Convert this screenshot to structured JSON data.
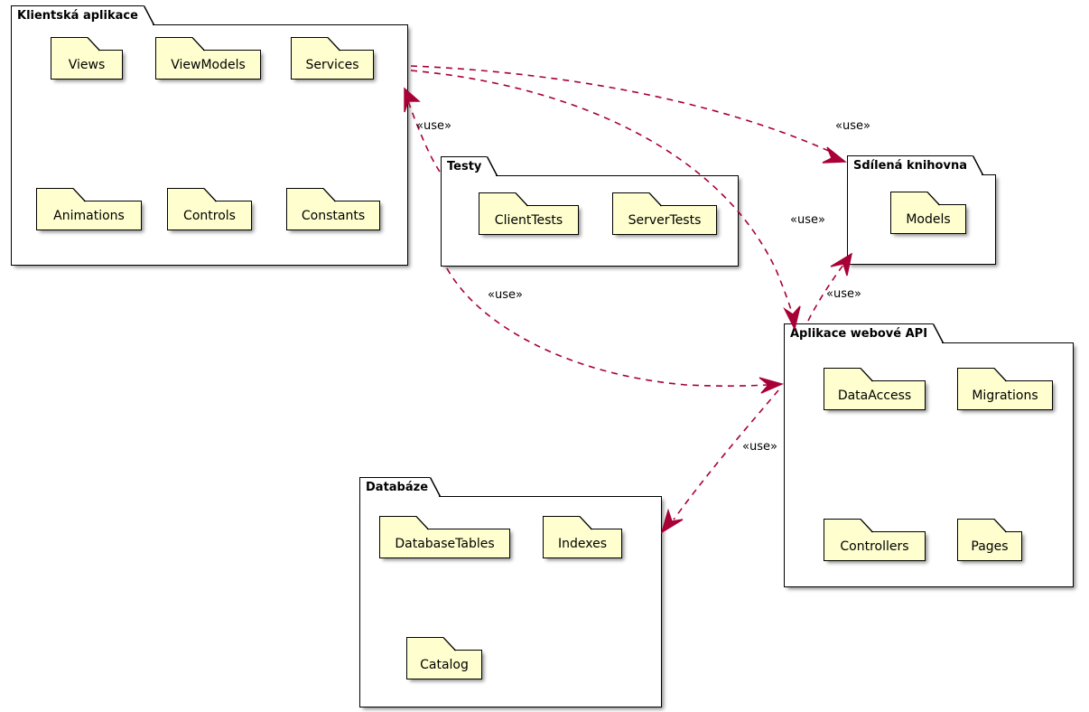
{
  "diagram": {
    "kind": "uml-package-diagram",
    "colors": {
      "node_fill": "#FEFECE",
      "node_border": "#000000",
      "package_fill": "#FFFFFF",
      "package_border": "#000000",
      "arrow": "#A80036",
      "background": "#FFFFFF"
    }
  },
  "packages": [
    {
      "id": "client",
      "title": "Klientská aplikace",
      "nodes": [
        {
          "label": "Views"
        },
        {
          "label": "ViewModels"
        },
        {
          "label": "Services"
        },
        {
          "label": "Animations"
        },
        {
          "label": "Controls"
        },
        {
          "label": "Constants"
        }
      ]
    },
    {
      "id": "tests",
      "title": "Testy",
      "nodes": [
        {
          "label": "ClientTests"
        },
        {
          "label": "ServerTests"
        }
      ]
    },
    {
      "id": "shared",
      "title": "Sdílená knihovna",
      "nodes": [
        {
          "label": "Models"
        }
      ]
    },
    {
      "id": "webapi",
      "title": "Aplikace webové API",
      "nodes": [
        {
          "label": "DataAccess"
        },
        {
          "label": "Migrations"
        },
        {
          "label": "Controllers"
        },
        {
          "label": "Pages"
        }
      ]
    },
    {
      "id": "database",
      "title": "Databáze",
      "nodes": [
        {
          "label": "DatabaseTables"
        },
        {
          "label": "Indexes"
        },
        {
          "label": "Catalog"
        }
      ]
    }
  ],
  "dependencies": [
    {
      "id": "client-to-shared",
      "from": "client",
      "to": "shared",
      "stereotype": "«use»"
    },
    {
      "id": "client-to-webapi",
      "from": "client",
      "to": "webapi",
      "stereotype": "«use»"
    },
    {
      "id": "tests-to-client",
      "from": "tests",
      "to": "client",
      "stereotype": "«use»"
    },
    {
      "id": "tests-to-webapi",
      "from": "tests",
      "to": "webapi",
      "stereotype": "«use»"
    },
    {
      "id": "webapi-to-shared",
      "from": "webapi",
      "to": "shared",
      "stereotype": "«use»"
    },
    {
      "id": "webapi-to-database",
      "from": "webapi",
      "to": "database",
      "stereotype": "«use»"
    }
  ]
}
